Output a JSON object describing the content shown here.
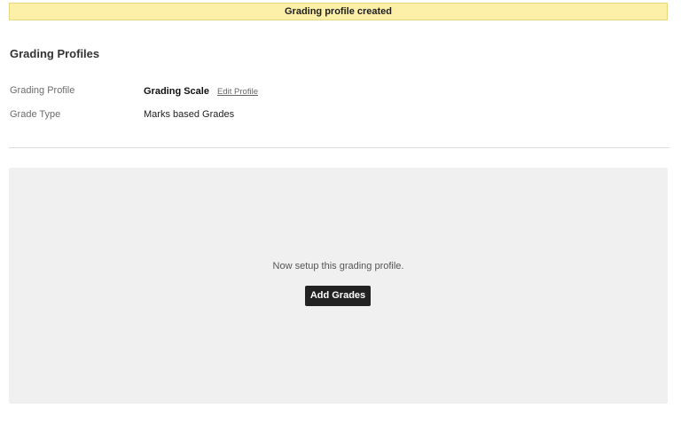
{
  "flash": {
    "message": "Grading profile created"
  },
  "page": {
    "title": "Grading Profiles"
  },
  "details": {
    "grading_profile": {
      "label": "Grading Profile",
      "value": "Grading Scale",
      "edit_link": "Edit Profile"
    },
    "grade_type": {
      "label": "Grade Type",
      "value": "Marks based Grades"
    }
  },
  "setup": {
    "message": "Now setup this grading profile.",
    "add_button": "Add Grades"
  },
  "colors": {
    "flash_bg": "#fcefa8",
    "panel_bg": "#f0f0f0",
    "button_bg": "#222222"
  }
}
